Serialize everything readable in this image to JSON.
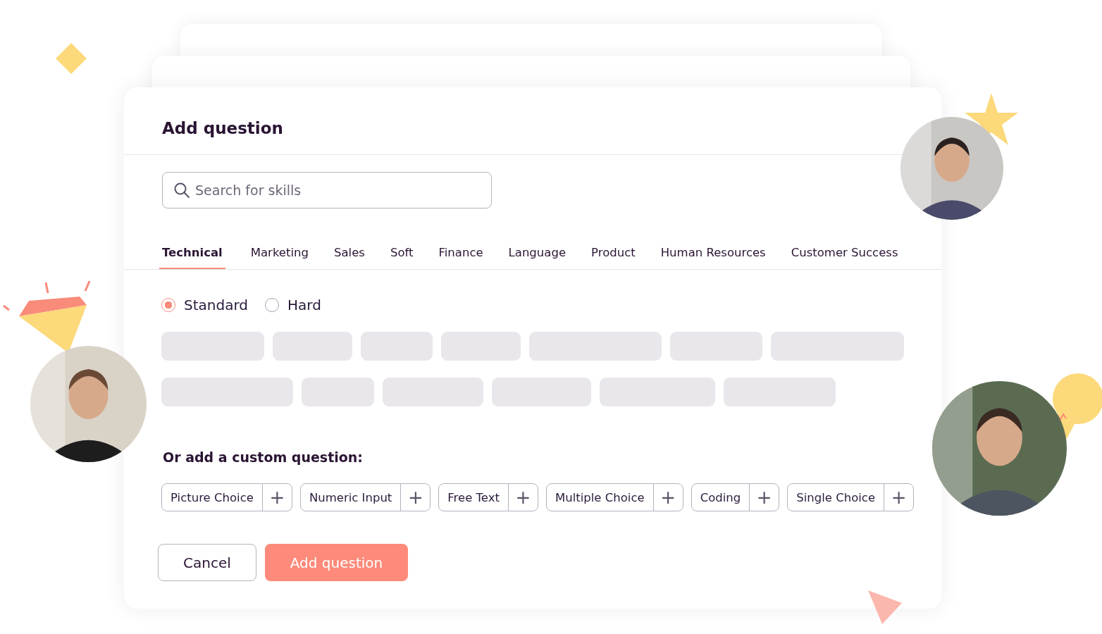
{
  "dialog": {
    "title": "Add question"
  },
  "search": {
    "placeholder": "Search for skills"
  },
  "tabs": [
    {
      "label": "Technical",
      "selected": true
    },
    {
      "label": "Marketing",
      "selected": false
    },
    {
      "label": "Sales",
      "selected": false
    },
    {
      "label": "Soft",
      "selected": false
    },
    {
      "label": "Finance",
      "selected": false
    },
    {
      "label": "Language",
      "selected": false
    },
    {
      "label": "Product",
      "selected": false
    },
    {
      "label": "Human Resources",
      "selected": false
    },
    {
      "label": "Customer Success",
      "selected": false
    }
  ],
  "difficulty": [
    {
      "label": "Standard",
      "selected": true
    },
    {
      "label": "Hard",
      "selected": false
    }
  ],
  "custom_heading": "Or add a custom question:",
  "question_types": [
    {
      "label": "Picture Choice",
      "icon": "+"
    },
    {
      "label": "Numeric Input",
      "icon": "+"
    },
    {
      "label": "Free Text",
      "icon": "+"
    },
    {
      "label": "Multiple Choice",
      "icon": "+"
    },
    {
      "label": "Coding",
      "icon": "+"
    },
    {
      "label": "Single Choice",
      "icon": "+"
    }
  ],
  "buttons": [
    {
      "label": "Cancel",
      "kind": "secondary"
    },
    {
      "label": "Add question",
      "kind": "primary"
    }
  ]
}
